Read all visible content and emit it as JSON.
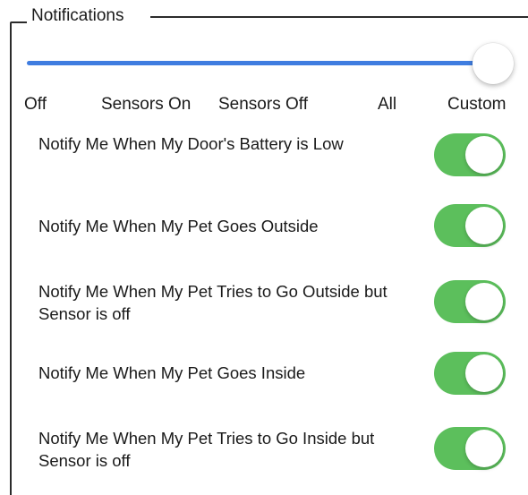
{
  "section": {
    "title": "Notifications"
  },
  "slider": {
    "options": [
      "Off",
      "Sensors On",
      "Sensors Off",
      "All",
      "Custom"
    ],
    "selected": "Custom",
    "color": "#3f7de0"
  },
  "toggle_color": "#5cbf5c",
  "notifications": [
    {
      "label": "Notify Me When My Door's Battery is Low",
      "enabled": true
    },
    {
      "label": "Notify Me When My Pet Goes Outside",
      "enabled": true
    },
    {
      "label": "Notify Me When My Pet Tries to Go Outside but Sensor is off",
      "enabled": true
    },
    {
      "label": "Notify Me When My Pet Goes Inside",
      "enabled": true
    },
    {
      "label": "Notify Me When My Pet Tries to Go Inside but Sensor is off",
      "enabled": true
    }
  ]
}
